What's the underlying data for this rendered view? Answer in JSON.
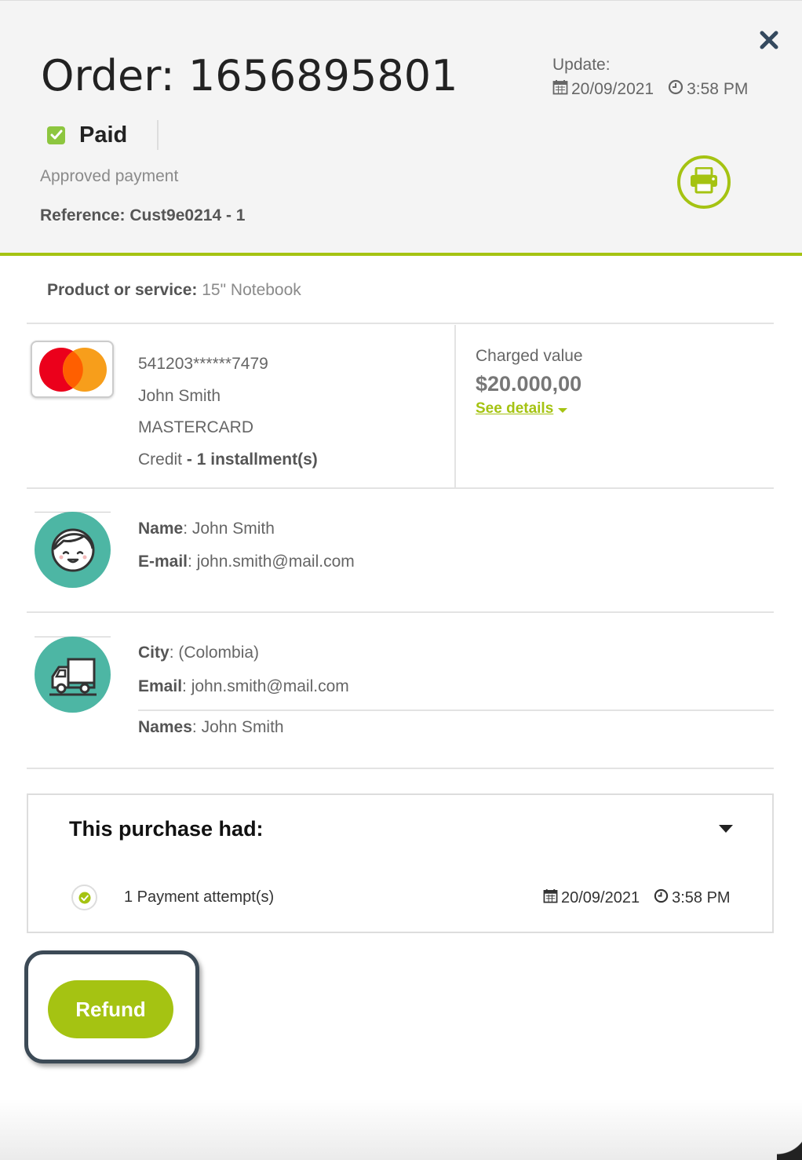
{
  "header": {
    "order_title": "Order: 1656895801",
    "status": "Paid",
    "status_color": "#8dc63f",
    "approved_text": "Approved payment",
    "reference": "Reference: Cust9e0214 - 1",
    "update_label": "Update:",
    "update_date": "20/09/2021",
    "update_time": "3:58 PM",
    "accent_color": "#a5c312"
  },
  "product": {
    "label": "Product or service",
    "value": "15\" Notebook"
  },
  "card": {
    "brand_icon": "mastercard-logo",
    "number": "541203******7479",
    "holder": "John Smith",
    "network": "MASTERCARD",
    "type": "Credit",
    "installments": "1 installment(s)",
    "charged_label": "Charged value",
    "charged_value": "$20.000,00",
    "see_details": "See details"
  },
  "customer": {
    "icon": "customer-face-icon",
    "name_label": "Name",
    "name": "John Smith",
    "email_label": "E-mail",
    "email": "john.smith@mail.com"
  },
  "shipping": {
    "icon": "delivery-truck-icon",
    "city_label": "City",
    "city": "(Colombia)",
    "email_label": "Email",
    "email": "john.smith@mail.com",
    "names_label": "Names",
    "names": "John Smith"
  },
  "purchase": {
    "title": "This purchase had:",
    "attempt_text": "1 Payment attempt(s)",
    "attempt_date": "20/09/2021",
    "attempt_time": "3:58 PM"
  },
  "actions": {
    "refund_label": "Refund"
  }
}
